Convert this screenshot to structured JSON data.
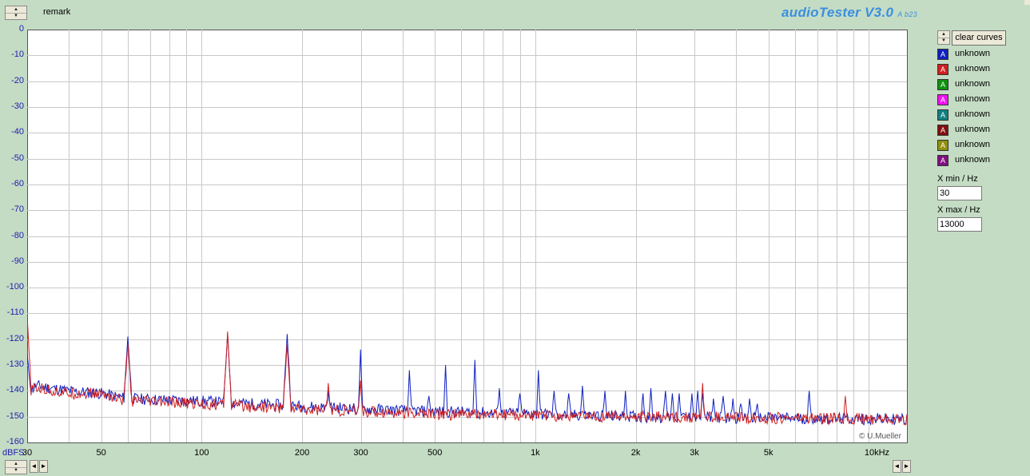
{
  "app": {
    "title": "audioTester V3.0",
    "version": "A b23",
    "remark": "remark",
    "copyright": "© U.Mueller"
  },
  "controls": {
    "clear_curves": "clear curves",
    "xmin_label": "X min / Hz",
    "xmin_value": "30",
    "xmax_label": "X max / Hz",
    "xmax_value": "13000"
  },
  "legend": [
    {
      "glyph": "A",
      "label": "unknown",
      "color": "#1020c0"
    },
    {
      "glyph": "A",
      "label": "unknown",
      "color": "#d02020"
    },
    {
      "glyph": "A",
      "label": "unknown",
      "color": "#109010"
    },
    {
      "glyph": "A",
      "label": "unknown",
      "color": "#f010f0"
    },
    {
      "glyph": "A",
      "label": "unknown",
      "color": "#108080"
    },
    {
      "glyph": "A",
      "label": "unknown",
      "color": "#801010"
    },
    {
      "glyph": "A",
      "label": "unknown",
      "color": "#909010"
    },
    {
      "glyph": "A",
      "label": "unknown",
      "color": "#801080"
    }
  ],
  "chart_data": {
    "type": "line",
    "xscale": "log",
    "xlim": [
      30,
      13000
    ],
    "ylim": [
      -160,
      0
    ],
    "ylabel": "dBFS",
    "yticks": [
      "0",
      "-10",
      "-20",
      "-30",
      "-40",
      "-50",
      "-60",
      "-70",
      "-80",
      "-90",
      "-100",
      "-110",
      "-120",
      "-130",
      "-140",
      "-150",
      "-160"
    ],
    "xticks": [
      {
        "v": 30,
        "label": "30"
      },
      {
        "v": 50,
        "label": "50"
      },
      {
        "v": 100,
        "label": "100"
      },
      {
        "v": 200,
        "label": "200"
      },
      {
        "v": 300,
        "label": "300"
      },
      {
        "v": 500,
        "label": "500"
      },
      {
        "v": 1000,
        "label": "1k"
      },
      {
        "v": 2000,
        "label": "2k"
      },
      {
        "v": 3000,
        "label": "3k"
      },
      {
        "v": 5000,
        "label": "5k"
      },
      {
        "v": 10000,
        "label": "10kHz"
      }
    ],
    "grid": true,
    "series": [
      {
        "color": "#1020c0",
        "floor": [
          [
            30,
            -141
          ],
          [
            32,
            -138
          ],
          [
            40,
            -140
          ],
          [
            50,
            -141
          ],
          [
            60,
            -143
          ],
          [
            100,
            -144
          ],
          [
            200,
            -146
          ],
          [
            300,
            -147
          ],
          [
            500,
            -148
          ],
          [
            1000,
            -149
          ],
          [
            2000,
            -150
          ],
          [
            5000,
            -150.5
          ],
          [
            13000,
            -151
          ]
        ],
        "peaks": [
          [
            30,
            -126
          ],
          [
            60,
            -119
          ],
          [
            120,
            -118
          ],
          [
            180,
            -118
          ],
          [
            240,
            -140
          ],
          [
            300,
            -124
          ],
          [
            420,
            -132
          ],
          [
            480,
            -142
          ],
          [
            540,
            -130
          ],
          [
            660,
            -128
          ],
          [
            780,
            -139
          ],
          [
            900,
            -141
          ],
          [
            1020,
            -132
          ],
          [
            1140,
            -140
          ],
          [
            1260,
            -141
          ],
          [
            1380,
            -138
          ],
          [
            1620,
            -140
          ],
          [
            1860,
            -140
          ],
          [
            2100,
            -141
          ],
          [
            2220,
            -139
          ],
          [
            2460,
            -140
          ],
          [
            2580,
            -141
          ],
          [
            2700,
            -141
          ],
          [
            2940,
            -141
          ],
          [
            3060,
            -140
          ],
          [
            3180,
            -141
          ],
          [
            3420,
            -143
          ],
          [
            3660,
            -142
          ],
          [
            3900,
            -143
          ],
          [
            4140,
            -145
          ],
          [
            4380,
            -143
          ],
          [
            4620,
            -145
          ],
          [
            6600,
            -140
          ]
        ]
      },
      {
        "color": "#d02020",
        "floor": [
          [
            30,
            -140
          ],
          [
            32,
            -139
          ],
          [
            40,
            -141
          ],
          [
            50,
            -141
          ],
          [
            60,
            -144
          ],
          [
            100,
            -145
          ],
          [
            200,
            -147
          ],
          [
            300,
            -148
          ],
          [
            500,
            -149
          ],
          [
            1000,
            -149.5
          ],
          [
            2000,
            -150
          ],
          [
            5000,
            -150.5
          ],
          [
            13000,
            -151
          ]
        ],
        "peaks": [
          [
            30,
            -111
          ],
          [
            60,
            -122
          ],
          [
            120,
            -117
          ],
          [
            180,
            -122
          ],
          [
            240,
            -137
          ],
          [
            300,
            -136
          ],
          [
            540,
            -148
          ],
          [
            3180,
            -137
          ],
          [
            8500,
            -142
          ]
        ]
      }
    ]
  }
}
